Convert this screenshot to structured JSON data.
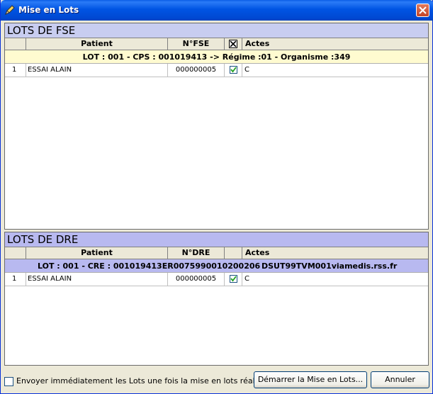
{
  "window": {
    "title": "Mise en Lots"
  },
  "fse": {
    "section_title": "LOTS DE FSE",
    "columns": [
      "",
      "Patient",
      "N°FSE",
      "",
      "Actes"
    ],
    "lot_label": "LOT : 001  - CPS : 001019413 -> Régime :01 - Organisme :349",
    "rows": [
      {
        "num": "1",
        "patient": "ESSAI ALAIN",
        "number": "000000005",
        "checked": true,
        "actes": "C"
      }
    ]
  },
  "dre": {
    "section_title": "LOTS DE DRE",
    "columns": [
      "",
      "Patient",
      "N°DRE",
      "",
      "Actes"
    ],
    "lot_label": "LOT : 001 - CRE : 001019413ER0075990010200206",
    "lot_address": "DSUT99TVM001viamedis.rss.fr",
    "rows": [
      {
        "num": "1",
        "patient": "ESSAI ALAIN",
        "number": "000000005",
        "checked": true,
        "actes": "C"
      }
    ]
  },
  "footer": {
    "send_checkbox_label": "Envoyer immédiatement les Lots une fois la mise en lots réalisée...",
    "send_checked": false,
    "start_button": "Démarrer la Mise en Lots...",
    "cancel_button": "Annuler"
  },
  "colors": {
    "titlebar": "#0054e3",
    "fse_header": "#c8cdf0",
    "dre_header": "#b8b9f0",
    "fse_lot_row": "#fffbd0"
  }
}
